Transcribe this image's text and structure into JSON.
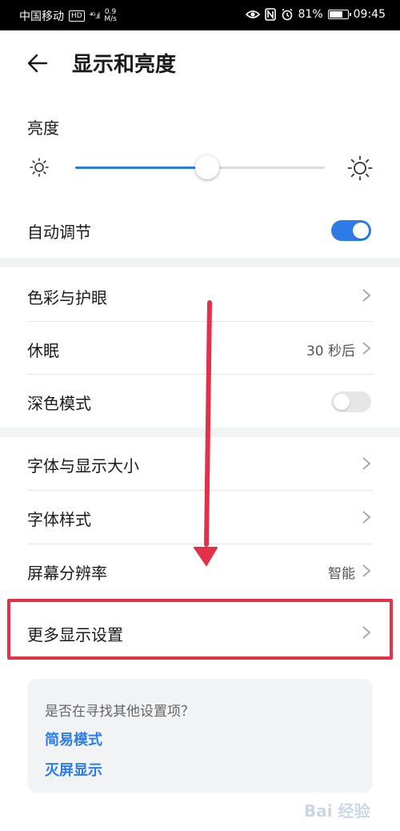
{
  "status_bar": {
    "carrier": "中国移动",
    "hd": "HD",
    "signal": "⁴ᴳ.ıl",
    "speed_value": "0.9",
    "speed_unit": "M/s",
    "battery": "81%",
    "battery_level": 0.81,
    "time": "09:45"
  },
  "header": {
    "title": "显示和亮度"
  },
  "brightness": {
    "label": "亮度",
    "level": 0.53
  },
  "auto_adjust": {
    "label": "自动调节",
    "enabled": true
  },
  "group1": {
    "color_eye": {
      "label": "色彩与护眼"
    },
    "sleep": {
      "label": "休眠",
      "value": "30 秒后"
    },
    "dark_mode": {
      "label": "深色模式",
      "enabled": false
    }
  },
  "group2": {
    "font_size": {
      "label": "字体与显示大小"
    },
    "font_style": {
      "label": "字体样式"
    },
    "resolution": {
      "label": "屏幕分辨率",
      "value": "智能"
    },
    "more_display": {
      "label": "更多显示设置"
    }
  },
  "suggestion": {
    "question": "是否在寻找其他设置项？",
    "link_simple": "简易模式",
    "link_aod": "灭屏显示"
  },
  "watermark": {
    "text": "Bai 经验"
  },
  "colors": {
    "accent": "#2d7ce6",
    "annotation": "#e23148"
  }
}
